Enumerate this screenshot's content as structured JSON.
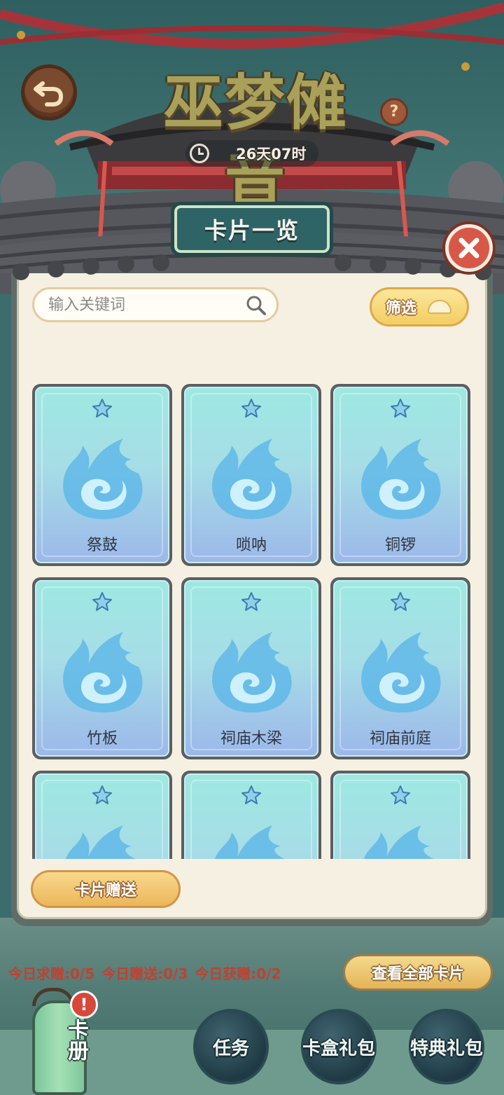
{
  "header": {
    "title": "巫梦傩音",
    "help_label": "?",
    "timer_text": "26天07时"
  },
  "modal": {
    "title": "卡片一览",
    "search": {
      "placeholder": "输入关键词",
      "value": ""
    },
    "filter_label": "筛选",
    "gift_button_label": "卡片赠送"
  },
  "cards": [
    {
      "name": "祭鼓"
    },
    {
      "name": "唢呐"
    },
    {
      "name": "铜锣"
    },
    {
      "name": "竹板"
    },
    {
      "name": "祠庙木梁"
    },
    {
      "name": "祠庙前庭"
    },
    {
      "name": ""
    },
    {
      "name": ""
    },
    {
      "name": ""
    }
  ],
  "bottom": {
    "daily_request": "今日求赠:0/5",
    "daily_gift": "今日赠送:0/3",
    "daily_received": "今日获赠:0/2",
    "view_all_label": "查看全部卡片",
    "album_label": "卡册",
    "alert_badge": "!",
    "tasks_label": "任务",
    "card_box_pack_label": "卡盒礼包",
    "special_pack_label": "特典礼包"
  },
  "colors": {
    "card_gradient_top": "#9ee8e2",
    "card_gradient_bottom": "#9cb8ea",
    "flame": "#5fb8e8",
    "close_button": "#d85848",
    "stats_text": "#c2402f"
  },
  "icons": {
    "back": "back-arrow-icon",
    "help": "question-icon",
    "timer": "clock-icon",
    "close": "close-icon",
    "search": "search-icon",
    "filter": "chevron-down-icon",
    "card_rarity": "star-icon",
    "card_art": "blue-flame-icon"
  }
}
